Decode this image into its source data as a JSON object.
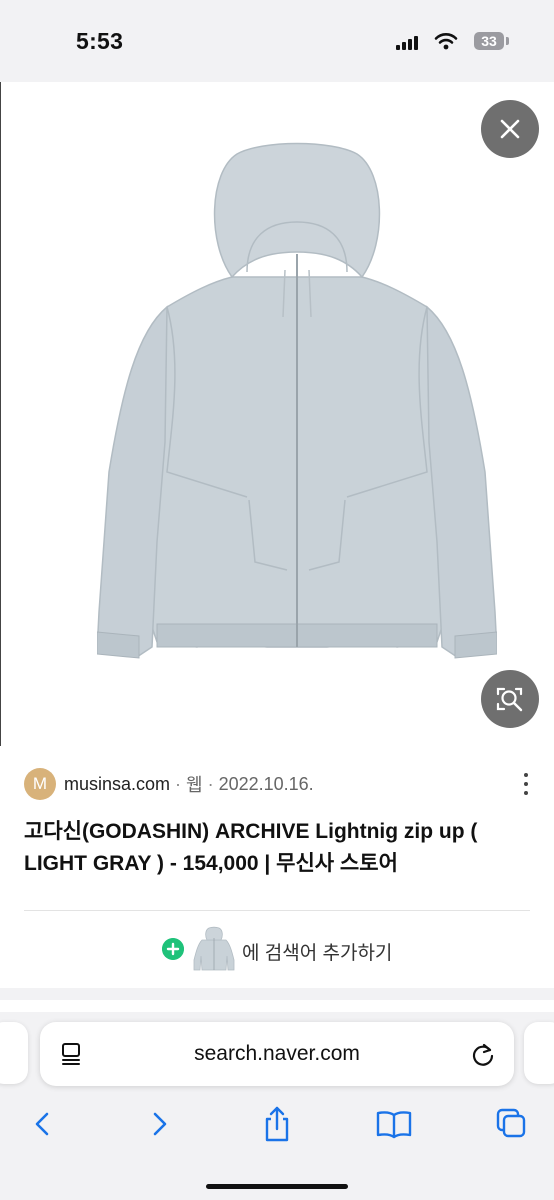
{
  "status_bar": {
    "time": "5:53",
    "battery_level": "33",
    "icons": [
      "cellular-signal-icon",
      "wifi-icon",
      "battery-icon"
    ]
  },
  "viewer": {
    "image_subject": "light gray hooded zip-up jacket",
    "buttons": [
      "close-icon",
      "visual-search-icon"
    ]
  },
  "result": {
    "favicon_letter": "M",
    "favicon_color": "#d8b27a",
    "domain": "musinsa.com",
    "separator": "·",
    "type": "웹",
    "date": "2022.10.16.",
    "title": "고다신(GODASHIN) ARCHIVE Lightnig zip up ( LIGHT GRAY ) - 154,000 | 무신사 스토어",
    "add_keyword_text": "에 검색어 추가하기",
    "add_icon_color": "#1fc27a"
  },
  "browser": {
    "url": "search.naver.com",
    "accent_color": "#1a73e8",
    "toolbar": [
      "back-icon",
      "forward-icon",
      "share-icon",
      "bookmarks-icon",
      "tabs-icon"
    ]
  }
}
